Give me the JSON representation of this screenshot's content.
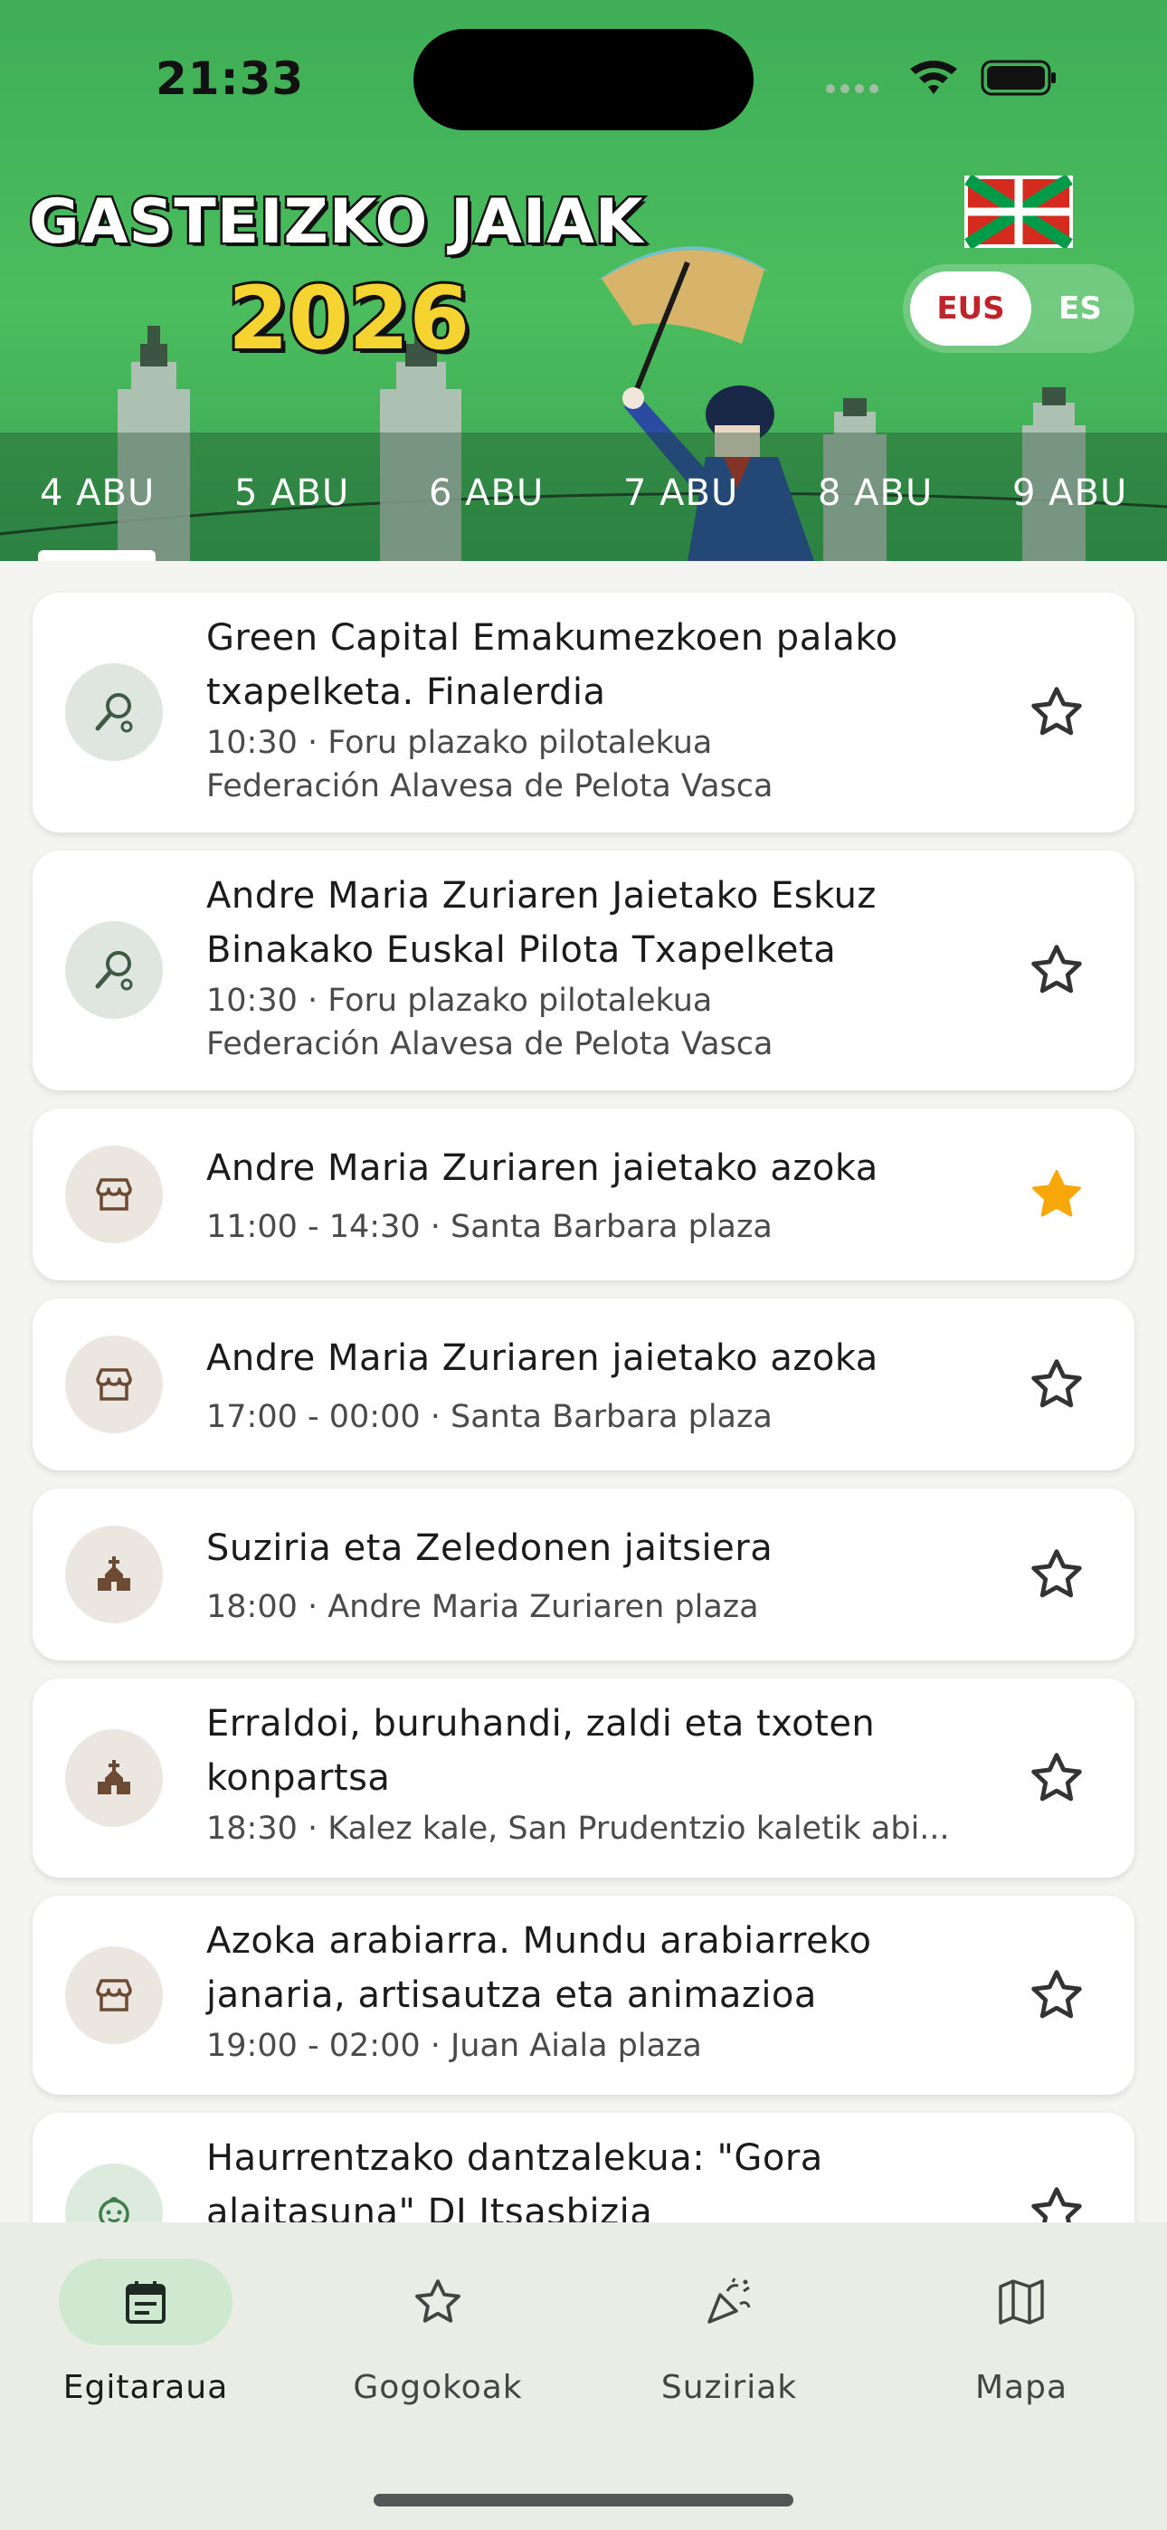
{
  "status_bar": {
    "time": "21:33"
  },
  "header": {
    "title_line1": "GASTEIZKO JAIAK",
    "title_line2": "2026",
    "language": {
      "options": [
        "EUS",
        "ES"
      ],
      "selected": "EUS"
    },
    "dates": [
      "4 ABU",
      "5 ABU",
      "6 ABU",
      "7 ABU",
      "8 ABU",
      "9 ABU"
    ],
    "selected_date": "4 ABU"
  },
  "events": [
    {
      "icon": "pelota-racket-icon",
      "title": "Green Capital Emakumezkoen palako txapelketa. Finalerdia",
      "time_place": "10:30 · Foru plazako pilotalekua",
      "organizer": "Federación Alavesa de Pelota Vasca",
      "favorite": false
    },
    {
      "icon": "pelota-racket-icon",
      "title": "Andre Maria Zuriaren Jaietako Eskuz Binakako Euskal Pilota Txapelketa",
      "time_place": "10:30 · Foru plazako pilotalekua",
      "organizer": "Federación Alavesa de Pelota Vasca",
      "favorite": false
    },
    {
      "icon": "market-stall-icon",
      "title": "Andre Maria Zuriaren jaietako azoka",
      "time_place": "11:00 - 14:30 · Santa Barbara plaza",
      "organizer": "",
      "favorite": true
    },
    {
      "icon": "market-stall-icon",
      "title": "Andre Maria Zuriaren jaietako azoka",
      "time_place": "17:00 - 00:00 · Santa Barbara plaza",
      "organizer": "",
      "favorite": false
    },
    {
      "icon": "church-icon",
      "title": "Suziria eta Zeledonen jaitsiera",
      "time_place": "18:00 · Andre Maria Zuriaren plaza",
      "organizer": "",
      "favorite": false
    },
    {
      "icon": "church-icon",
      "title": "Erraldoi, buruhandi, zaldi eta txoten konpartsa",
      "time_place": "18:30 · Kalez kale, San Prudentzio kaletik abi...",
      "organizer": "",
      "favorite": false
    },
    {
      "icon": "market-stall-icon",
      "title": "Azoka arabiarra. Mundu arabiarreko janaria, artisautza eta animazioa",
      "time_place": "19:00 - 02:00 · Juan Aiala plaza",
      "organizer": "",
      "favorite": false
    },
    {
      "icon": "child-face-icon",
      "title": "Haurrentzako dantzalekua: \"Gora alaitasuna\" DJ Itsasbizia",
      "time_place": "",
      "organizer": "",
      "favorite": false
    }
  ],
  "bottom_nav": [
    {
      "label": "Egitaraua",
      "icon": "calendar-icon",
      "active": true
    },
    {
      "label": "Gogokoak",
      "icon": "star-icon",
      "active": false
    },
    {
      "label": "Suziriak",
      "icon": "party-popper-icon",
      "active": false
    },
    {
      "label": "Mapa",
      "icon": "map-icon",
      "active": false
    }
  ],
  "colors": {
    "header_green": "#4bbd5e",
    "favorite_star": "#f7a707",
    "nav_active_pill": "#cfe9d0",
    "language_selected_text": "#c0232a"
  }
}
